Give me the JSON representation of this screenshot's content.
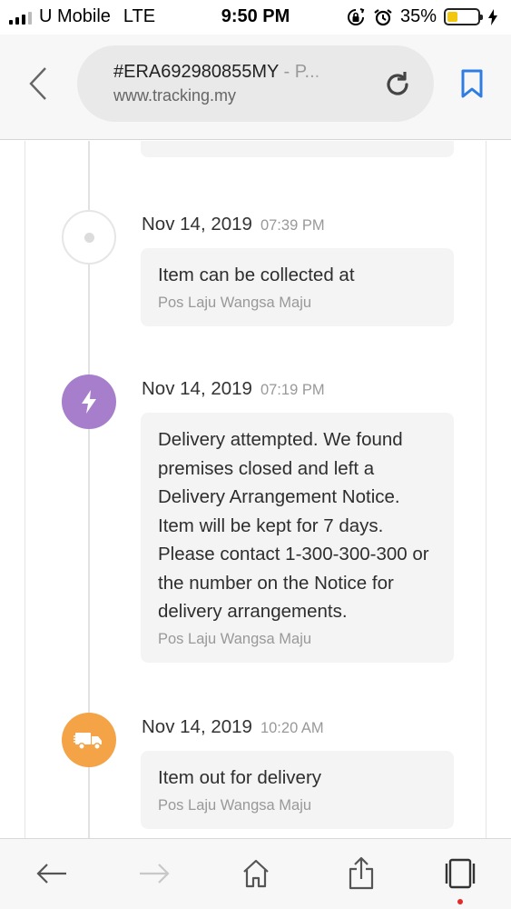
{
  "status_bar": {
    "carrier": "U Mobile",
    "network": "LTE",
    "time": "9:50 PM",
    "battery_percent": "35%",
    "battery_level": 0.35,
    "battery_color": "#f2c80f",
    "icons": [
      "signal-icon",
      "rotation-lock-icon",
      "alarm-icon",
      "battery-icon",
      "charging-bolt-icon"
    ]
  },
  "browser": {
    "page_title": "#ERA692980855MY",
    "page_title_suffix": " - P...",
    "host": "www.tracking.my",
    "icons": [
      "back-chevron-icon",
      "reload-icon",
      "bookmark-icon"
    ],
    "accent_color": "#2f7de1"
  },
  "timeline": {
    "events": [
      {
        "date": "Nov 14, 2019",
        "time": "07:39 PM",
        "message": "Item can be collected at",
        "location": "Pos Laju Wangsa Maju",
        "icon": "empty-dot-icon"
      },
      {
        "date": "Nov 14, 2019",
        "time": "07:19 PM",
        "message": "Delivery attempted. We found premises closed and left a Delivery Arrangement Notice. Item will be kept for 7 days. Please contact 1-300-300-300 or the number on the Notice for delivery arrangements.",
        "location": "Pos Laju Wangsa Maju",
        "icon": "lightning-icon",
        "color": "#a67ecb"
      },
      {
        "date": "Nov 14, 2019",
        "time": "10:20 AM",
        "message": "Item out for delivery",
        "location": "Pos Laju Wangsa Maju",
        "icon": "delivery-truck-icon",
        "color": "#f4a346"
      }
    ]
  },
  "toolbar": {
    "icons": [
      "back-arrow-icon",
      "forward-arrow-icon",
      "home-icon",
      "share-icon",
      "tabs-icon"
    ]
  }
}
